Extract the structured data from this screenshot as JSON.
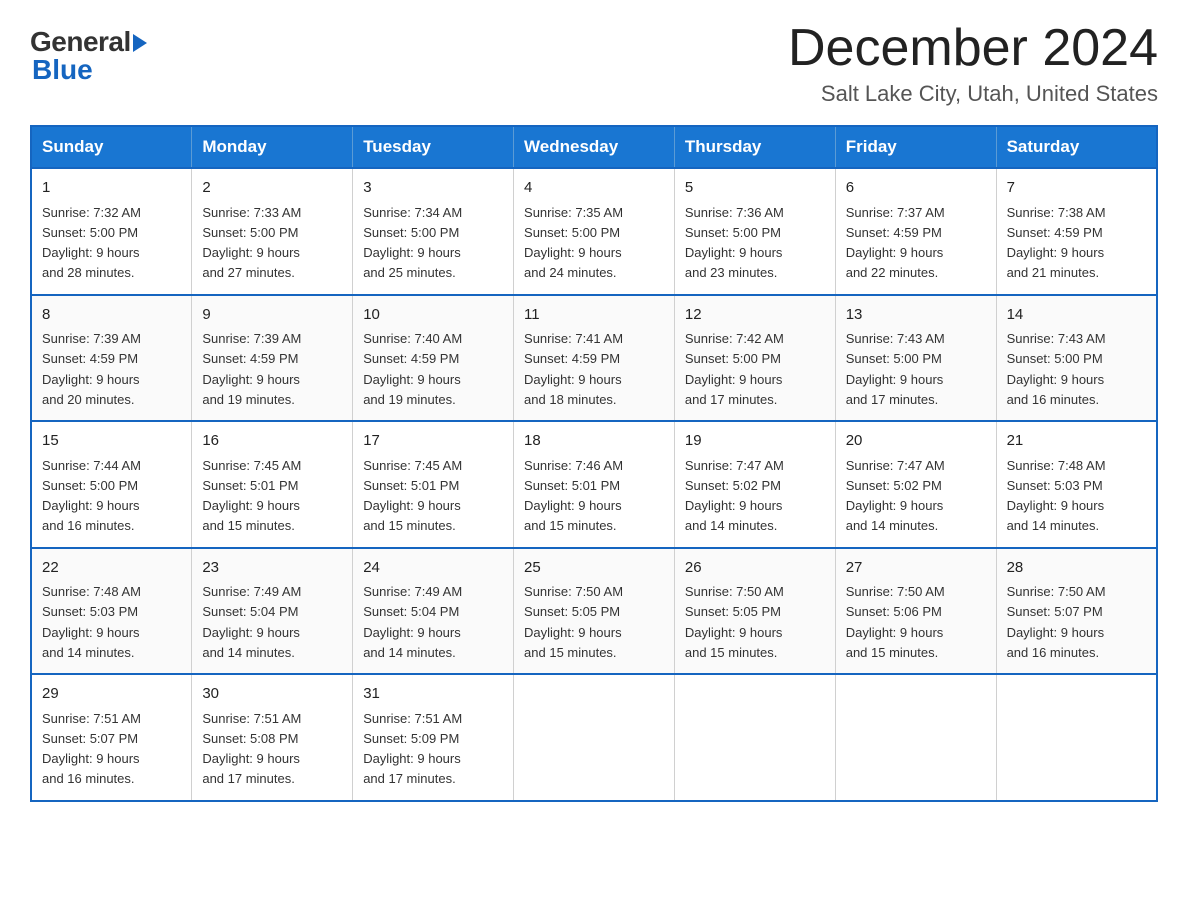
{
  "logo": {
    "general": "General",
    "blue": "Blue"
  },
  "title": "December 2024",
  "location": "Salt Lake City, Utah, United States",
  "days_of_week": [
    "Sunday",
    "Monday",
    "Tuesday",
    "Wednesday",
    "Thursday",
    "Friday",
    "Saturday"
  ],
  "weeks": [
    [
      {
        "day": "1",
        "sunrise": "7:32 AM",
        "sunset": "5:00 PM",
        "daylight": "9 hours and 28 minutes."
      },
      {
        "day": "2",
        "sunrise": "7:33 AM",
        "sunset": "5:00 PM",
        "daylight": "9 hours and 27 minutes."
      },
      {
        "day": "3",
        "sunrise": "7:34 AM",
        "sunset": "5:00 PM",
        "daylight": "9 hours and 25 minutes."
      },
      {
        "day": "4",
        "sunrise": "7:35 AM",
        "sunset": "5:00 PM",
        "daylight": "9 hours and 24 minutes."
      },
      {
        "day": "5",
        "sunrise": "7:36 AM",
        "sunset": "5:00 PM",
        "daylight": "9 hours and 23 minutes."
      },
      {
        "day": "6",
        "sunrise": "7:37 AM",
        "sunset": "4:59 PM",
        "daylight": "9 hours and 22 minutes."
      },
      {
        "day": "7",
        "sunrise": "7:38 AM",
        "sunset": "4:59 PM",
        "daylight": "9 hours and 21 minutes."
      }
    ],
    [
      {
        "day": "8",
        "sunrise": "7:39 AM",
        "sunset": "4:59 PM",
        "daylight": "9 hours and 20 minutes."
      },
      {
        "day": "9",
        "sunrise": "7:39 AM",
        "sunset": "4:59 PM",
        "daylight": "9 hours and 19 minutes."
      },
      {
        "day": "10",
        "sunrise": "7:40 AM",
        "sunset": "4:59 PM",
        "daylight": "9 hours and 19 minutes."
      },
      {
        "day": "11",
        "sunrise": "7:41 AM",
        "sunset": "4:59 PM",
        "daylight": "9 hours and 18 minutes."
      },
      {
        "day": "12",
        "sunrise": "7:42 AM",
        "sunset": "5:00 PM",
        "daylight": "9 hours and 17 minutes."
      },
      {
        "day": "13",
        "sunrise": "7:43 AM",
        "sunset": "5:00 PM",
        "daylight": "9 hours and 17 minutes."
      },
      {
        "day": "14",
        "sunrise": "7:43 AM",
        "sunset": "5:00 PM",
        "daylight": "9 hours and 16 minutes."
      }
    ],
    [
      {
        "day": "15",
        "sunrise": "7:44 AM",
        "sunset": "5:00 PM",
        "daylight": "9 hours and 16 minutes."
      },
      {
        "day": "16",
        "sunrise": "7:45 AM",
        "sunset": "5:01 PM",
        "daylight": "9 hours and 15 minutes."
      },
      {
        "day": "17",
        "sunrise": "7:45 AM",
        "sunset": "5:01 PM",
        "daylight": "9 hours and 15 minutes."
      },
      {
        "day": "18",
        "sunrise": "7:46 AM",
        "sunset": "5:01 PM",
        "daylight": "9 hours and 15 minutes."
      },
      {
        "day": "19",
        "sunrise": "7:47 AM",
        "sunset": "5:02 PM",
        "daylight": "9 hours and 14 minutes."
      },
      {
        "day": "20",
        "sunrise": "7:47 AM",
        "sunset": "5:02 PM",
        "daylight": "9 hours and 14 minutes."
      },
      {
        "day": "21",
        "sunrise": "7:48 AM",
        "sunset": "5:03 PM",
        "daylight": "9 hours and 14 minutes."
      }
    ],
    [
      {
        "day": "22",
        "sunrise": "7:48 AM",
        "sunset": "5:03 PM",
        "daylight": "9 hours and 14 minutes."
      },
      {
        "day": "23",
        "sunrise": "7:49 AM",
        "sunset": "5:04 PM",
        "daylight": "9 hours and 14 minutes."
      },
      {
        "day": "24",
        "sunrise": "7:49 AM",
        "sunset": "5:04 PM",
        "daylight": "9 hours and 14 minutes."
      },
      {
        "day": "25",
        "sunrise": "7:50 AM",
        "sunset": "5:05 PM",
        "daylight": "9 hours and 15 minutes."
      },
      {
        "day": "26",
        "sunrise": "7:50 AM",
        "sunset": "5:05 PM",
        "daylight": "9 hours and 15 minutes."
      },
      {
        "day": "27",
        "sunrise": "7:50 AM",
        "sunset": "5:06 PM",
        "daylight": "9 hours and 15 minutes."
      },
      {
        "day": "28",
        "sunrise": "7:50 AM",
        "sunset": "5:07 PM",
        "daylight": "9 hours and 16 minutes."
      }
    ],
    [
      {
        "day": "29",
        "sunrise": "7:51 AM",
        "sunset": "5:07 PM",
        "daylight": "9 hours and 16 minutes."
      },
      {
        "day": "30",
        "sunrise": "7:51 AM",
        "sunset": "5:08 PM",
        "daylight": "9 hours and 17 minutes."
      },
      {
        "day": "31",
        "sunrise": "7:51 AM",
        "sunset": "5:09 PM",
        "daylight": "9 hours and 17 minutes."
      },
      null,
      null,
      null,
      null
    ]
  ],
  "labels": {
    "sunrise": "Sunrise:",
    "sunset": "Sunset:",
    "daylight": "Daylight:"
  }
}
